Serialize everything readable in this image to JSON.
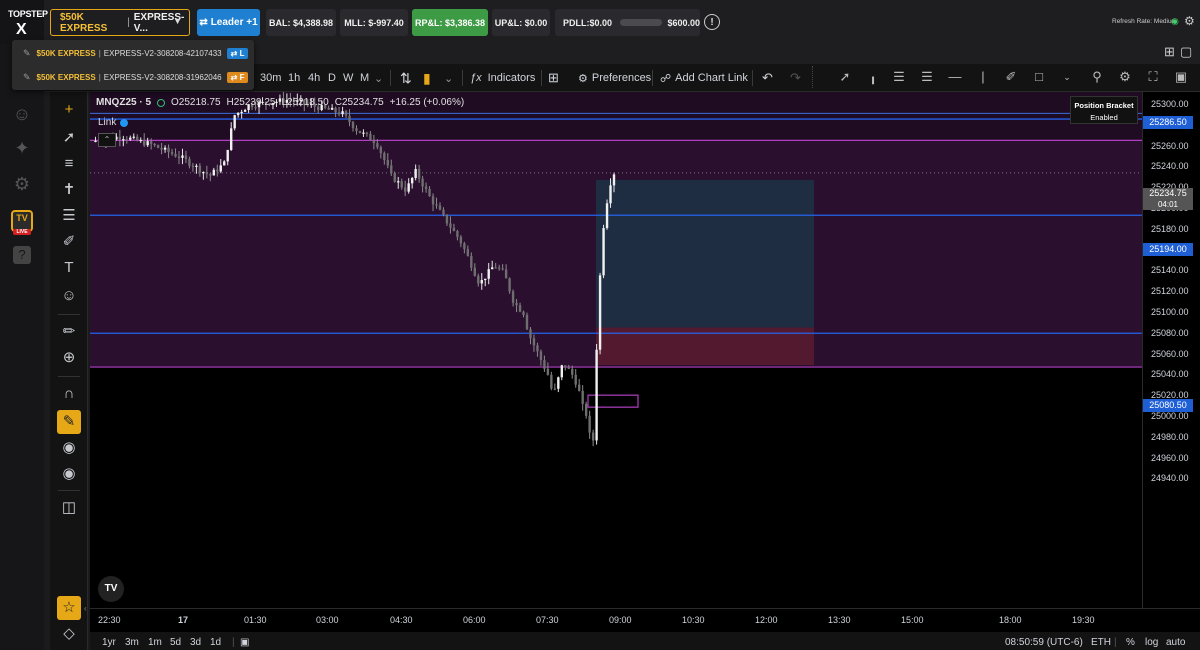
{
  "top": {
    "logo": "TOPSTEP",
    "logo_mark": "X",
    "account_name": "$50K EXPRESS",
    "account_id": "EXPRESS-V...",
    "leader_label": "Leader +1",
    "bal": "BAL: $4,388.98",
    "mll": "MLL: $-997.40",
    "rpl": "RP&L: $3,386.38",
    "upl": "UP&L: $0.00",
    "pdll_label": "PDLL:$0.00",
    "pdll_limit": "$600.00",
    "refresh": "Refresh Rate: Medium",
    "colors": {
      "accent": "#e6a817",
      "blue": "#1f7fd0",
      "green": "#3d9b46"
    }
  },
  "dropdown": [
    {
      "name": "$50K EXPRESS",
      "id": "EXPRESS-V2-308208-42107433",
      "tag": "L"
    },
    {
      "name": "$50K EXPRESS",
      "id": "EXPRESS-V2-308208-31962046",
      "tag": "F"
    }
  ],
  "toolbar": {
    "timeframes": [
      "30m",
      "1h",
      "4h",
      "D",
      "W",
      "M"
    ],
    "indicators": "Indicators",
    "preferences": "Preferences",
    "add_chart_link": "Add Chart Link"
  },
  "legend": {
    "symbol": "MNQZ25 · 5",
    "open": "O25218.75",
    "high": "H25239.25",
    "low": "L25218.50",
    "close": "C25234.75",
    "change": "+16.25 (+0.06%)",
    "link": "Link"
  },
  "position_bracket": {
    "title": "Position Bracket",
    "status": "Enabled"
  },
  "price_axis": {
    "ticks": [
      "25300.00",
      "25280.00",
      "25260.00",
      "25240.00",
      "25220.00",
      "25200.00",
      "25180.00",
      "25160.00",
      "25140.00",
      "25120.00",
      "25100.00",
      "25080.00",
      "25060.00",
      "25040.00",
      "25020.00",
      "25000.00",
      "24980.00",
      "24960.00",
      "24940.00"
    ],
    "label_upper": "25286.50",
    "label_current": "25234.75",
    "label_countdown": "04:01",
    "label_mid": "25194.00",
    "label_lower": "25080.50"
  },
  "time_axis": [
    "22:30",
    "17",
    "01:30",
    "03:00",
    "04:30",
    "06:00",
    "07:30",
    "09:00",
    "10:30",
    "12:00",
    "13:30",
    "15:00",
    "18:00",
    "19:30"
  ],
  "bottom": {
    "ranges": [
      "1yr",
      "3m",
      "1m",
      "5d",
      "3d",
      "1d"
    ],
    "clock": "08:50:59 (UTC-6)",
    "session": "ETH",
    "pct": "%",
    "log": "log",
    "auto": "auto"
  },
  "chart_data": {
    "type": "candlestick",
    "symbol": "MNQZ25",
    "interval": "5",
    "ylim": [
      24930,
      25310
    ],
    "current_price": 25234.75,
    "levels": [
      25286.5,
      25194.0,
      25080.5
    ],
    "zone_bounds": [
      25266,
      25048
    ],
    "path": [
      [
        0,
        25265
      ],
      [
        0.03,
        25270
      ],
      [
        0.06,
        25262
      ],
      [
        0.09,
        25250
      ],
      [
        0.12,
        25232
      ],
      [
        0.135,
        25244
      ],
      [
        0.145,
        25290
      ],
      [
        0.16,
        25300
      ],
      [
        0.2,
        25305
      ],
      [
        0.23,
        25298
      ],
      [
        0.255,
        25292
      ],
      [
        0.27,
        25276
      ],
      [
        0.29,
        25264
      ],
      [
        0.305,
        25232
      ],
      [
        0.32,
        25218
      ],
      [
        0.33,
        25236
      ],
      [
        0.345,
        25210
      ],
      [
        0.36,
        25190
      ],
      [
        0.375,
        25170
      ],
      [
        0.385,
        25150
      ],
      [
        0.395,
        25128
      ],
      [
        0.41,
        25146
      ],
      [
        0.42,
        25138
      ],
      [
        0.43,
        25110
      ],
      [
        0.44,
        25100
      ],
      [
        0.445,
        25080
      ],
      [
        0.455,
        25060
      ],
      [
        0.465,
        25040
      ],
      [
        0.47,
        25020
      ],
      [
        0.48,
        25052
      ],
      [
        0.49,
        25040
      ],
      [
        0.495,
        25030
      ],
      [
        0.5,
        25010
      ],
      [
        0.505,
        25000
      ],
      [
        0.51,
        24960
      ],
      [
        0.515,
        25085
      ],
      [
        0.52,
        25175
      ],
      [
        0.527,
        25222
      ],
      [
        0.532,
        25234.75
      ]
    ]
  }
}
